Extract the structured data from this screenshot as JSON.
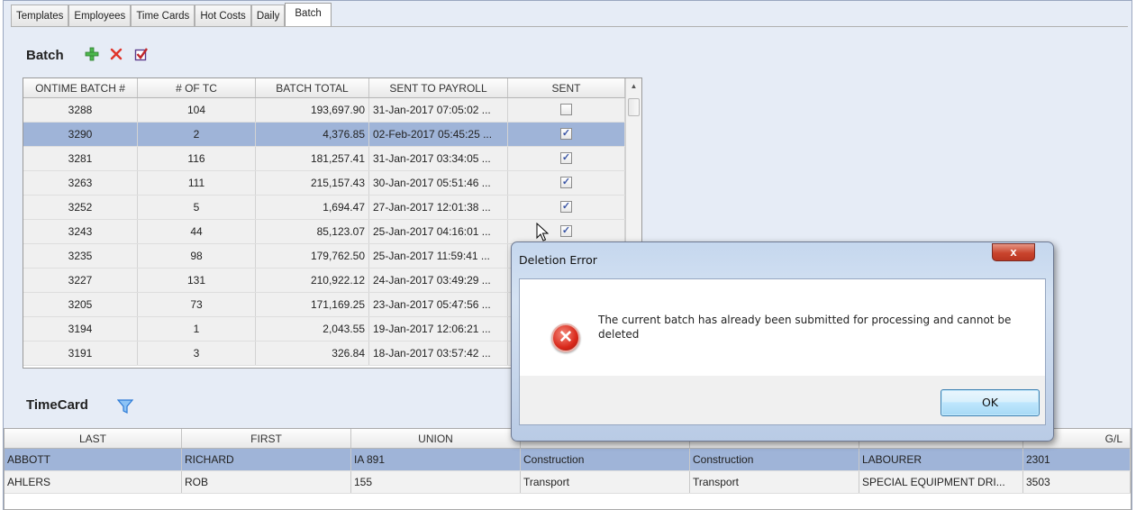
{
  "tabs": [
    "Templates",
    "Employees",
    "Time Cards",
    "Hot Costs",
    "Daily",
    "Batch"
  ],
  "active_tab": "Batch",
  "batch": {
    "title": "Batch",
    "columns": [
      "ONTIME BATCH #",
      "# OF TC",
      "BATCH TOTAL",
      "SENT TO PAYROLL",
      "SENT"
    ],
    "rows": [
      {
        "id": "3288",
        "tc": "104",
        "total": "193,697.90",
        "sent_to": "31-Jan-2017 07:05:02 ...",
        "sent": false
      },
      {
        "id": "3290",
        "tc": "2",
        "total": "4,376.85",
        "sent_to": "02-Feb-2017 05:45:25 ...",
        "sent": true
      },
      {
        "id": "3281",
        "tc": "116",
        "total": "181,257.41",
        "sent_to": "31-Jan-2017 03:34:05 ...",
        "sent": true
      },
      {
        "id": "3263",
        "tc": "111",
        "total": "215,157.43",
        "sent_to": "30-Jan-2017 05:51:46 ...",
        "sent": true
      },
      {
        "id": "3252",
        "tc": "5",
        "total": "1,694.47",
        "sent_to": "27-Jan-2017 12:01:38 ...",
        "sent": true
      },
      {
        "id": "3243",
        "tc": "44",
        "total": "85,123.07",
        "sent_to": "25-Jan-2017 04:16:01 ...",
        "sent": true
      },
      {
        "id": "3235",
        "tc": "98",
        "total": "179,762.50",
        "sent_to": "25-Jan-2017 11:59:41 ...",
        "sent": true
      },
      {
        "id": "3227",
        "tc": "131",
        "total": "210,922.12",
        "sent_to": "24-Jan-2017 03:49:29 ...",
        "sent": true
      },
      {
        "id": "3205",
        "tc": "73",
        "total": "171,169.25",
        "sent_to": "23-Jan-2017 05:47:56 ...",
        "sent": true
      },
      {
        "id": "3194",
        "tc": "1",
        "total": "2,043.55",
        "sent_to": "19-Jan-2017 12:06:21 ...",
        "sent": true
      },
      {
        "id": "3191",
        "tc": "3",
        "total": "326.84",
        "sent_to": "18-Jan-2017 03:57:42 ...",
        "sent": true
      }
    ],
    "selected_id": "3290"
  },
  "timecard": {
    "title": "TimeCard",
    "columns": [
      "LAST",
      "FIRST",
      "UNION",
      "",
      "",
      "",
      "G/L"
    ],
    "rows": [
      [
        "ABBOTT",
        "RICHARD",
        "IA 891",
        "Construction",
        "Construction",
        "LABOURER",
        "2301"
      ],
      [
        "AHLERS",
        "ROB",
        "155",
        "Transport",
        "Transport",
        "SPECIAL EQUIPMENT DRI...",
        "3503"
      ]
    ]
  },
  "dialog": {
    "title": "Deletion Error",
    "close_label": "x",
    "message": "The current batch has already been submitted for processing and cannot be deleted",
    "ok_label": "OK"
  },
  "colors": {
    "selection": "#9fb4d8",
    "panel": "#e6ecf6",
    "add_icon": "#3aa83a",
    "delete_icon": "#e0342a",
    "filter_icon": "#3b8fe0"
  }
}
